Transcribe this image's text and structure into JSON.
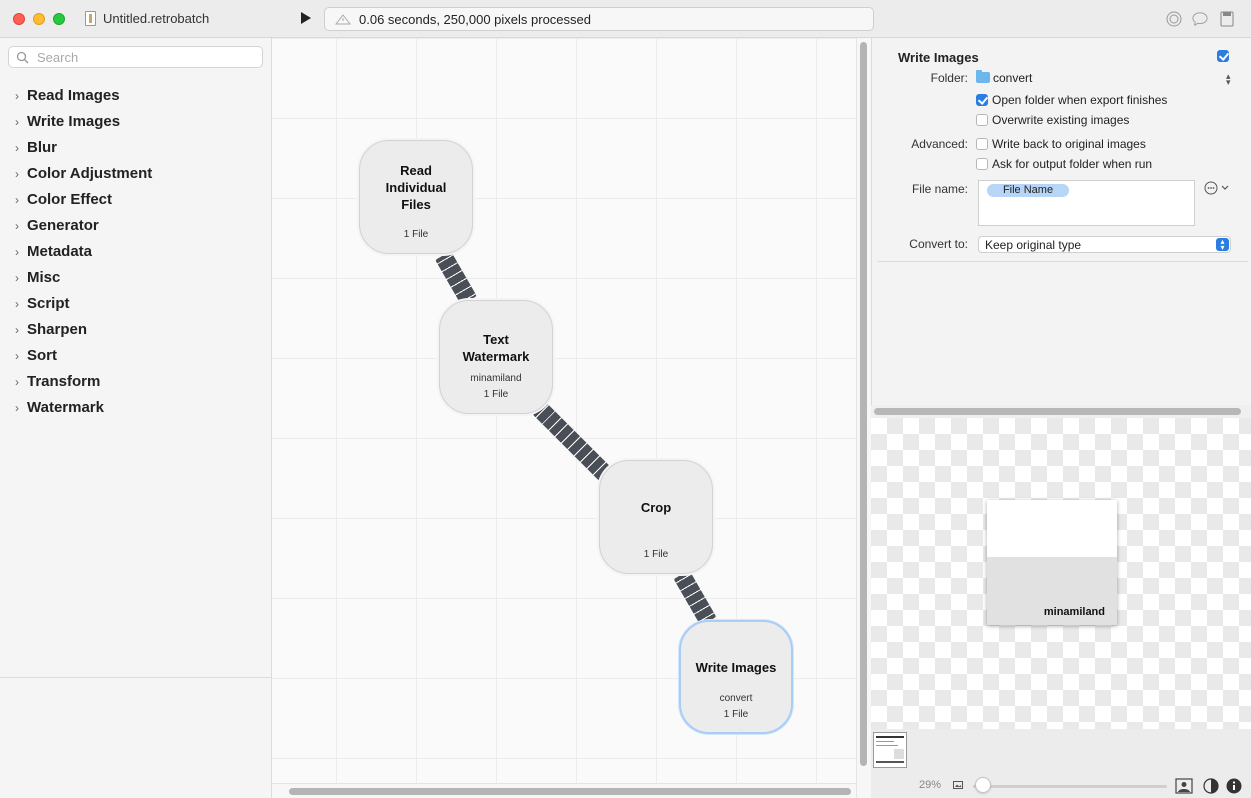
{
  "window": {
    "title": "Untitled.retrobatch",
    "status": "0.06 seconds, 250,000 pixels processed"
  },
  "sidebar": {
    "search_placeholder": "Search",
    "categories": [
      {
        "label": "Read Images"
      },
      {
        "label": "Write Images"
      },
      {
        "label": "Blur"
      },
      {
        "label": "Color Adjustment"
      },
      {
        "label": "Color Effect"
      },
      {
        "label": "Generator"
      },
      {
        "label": "Metadata"
      },
      {
        "label": "Misc"
      },
      {
        "label": "Script"
      },
      {
        "label": "Sharpen"
      },
      {
        "label": "Sort"
      },
      {
        "label": "Transform"
      },
      {
        "label": "Watermark"
      }
    ]
  },
  "canvas": {
    "nodes": [
      {
        "title_lines": [
          "Read",
          "Individual",
          "Files"
        ],
        "subtitle": "",
        "count": "1 File"
      },
      {
        "title_lines": [
          "Text",
          "Watermark"
        ],
        "subtitle": "minamiland",
        "count": "1 File"
      },
      {
        "title_lines": [
          "Crop"
        ],
        "subtitle": "",
        "count": "1 File"
      },
      {
        "title_lines": [
          "Write Images"
        ],
        "subtitle": "convert",
        "count": "1 File",
        "selected": true
      }
    ]
  },
  "inspector": {
    "title": "Write Images",
    "enabled": true,
    "folder_label": "Folder:",
    "folder_value": "convert",
    "open_folder_label": "Open folder when export finishes",
    "open_folder_checked": true,
    "overwrite_label": "Overwrite existing images",
    "overwrite_checked": false,
    "advanced_label": "Advanced:",
    "write_back_label": "Write back to original images",
    "write_back_checked": false,
    "ask_folder_label": "Ask for output folder when run",
    "ask_folder_checked": false,
    "file_name_label": "File name:",
    "file_name_token": "File Name",
    "convert_label": "Convert to:",
    "convert_value": "Keep original type"
  },
  "preview": {
    "watermark_text": "minamiland",
    "zoom": "29%"
  },
  "colors": {
    "accent": "#2a7de1",
    "token": "#b7d5f7",
    "node_selected_border": "#a9cdf5",
    "connector": "#4a4f57"
  }
}
